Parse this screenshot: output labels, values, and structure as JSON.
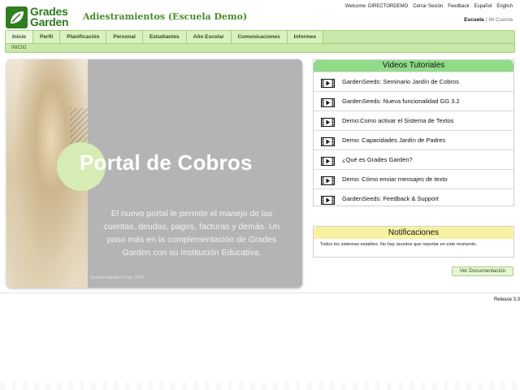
{
  "brand": {
    "line1": "Grades",
    "line2": "Garden",
    "color": "#2f7d1f"
  },
  "school_name": "Adiestramientos (Escuela Demo)",
  "top_links": [
    "Welcome: DIRECTORDEMO",
    "Cerrar Sesión",
    "Feedback",
    "Español",
    "English"
  ],
  "account": {
    "escuela": "Escuela",
    "separator": "|",
    "mi_cuenta": "Mi Cuenta"
  },
  "nav": {
    "tabs": [
      "Inicio",
      "Perfil",
      "Planificación",
      "Personal",
      "Estudiantes",
      "Año Escolar",
      "Comunicaciones",
      "Informes"
    ],
    "active": "Inicio",
    "breadcrumb": "INICIO"
  },
  "banner": {
    "title": "Portal de Cobros",
    "description": "El nuevo portal le permite el manejo de las cuentas, deudas, pagos, facturas y demás. Un paso más en la complementación de Grades Garden con su Institución Educativa.",
    "footer": "Grades Garden Corp. 2018"
  },
  "videos": {
    "title": "Videos Tutoriales",
    "items": [
      "GardenSeeds: Seminario Jardín de Cobros",
      "GardenSeeds: Nueva funcionalidad GG 3.2",
      "Demo:Como activar el Sistema de Textos",
      "Demo: Capacidades Jardín de Padres",
      "¿Qué es Grades Garden?",
      "Demo: Cómo enviar mensajes de texto",
      "GardenSeeds: Feedback & Support"
    ],
    "icon": "video-play-icon",
    "header_color": "#8fdc88"
  },
  "notifications": {
    "title": "Notificaciones",
    "message": "Todos los sistemas estables. No hay asuntos que reportar en este momento.",
    "header_color": "#f6f2a2"
  },
  "doc_button": "Ver Documentación",
  "release": "Release 3.3"
}
